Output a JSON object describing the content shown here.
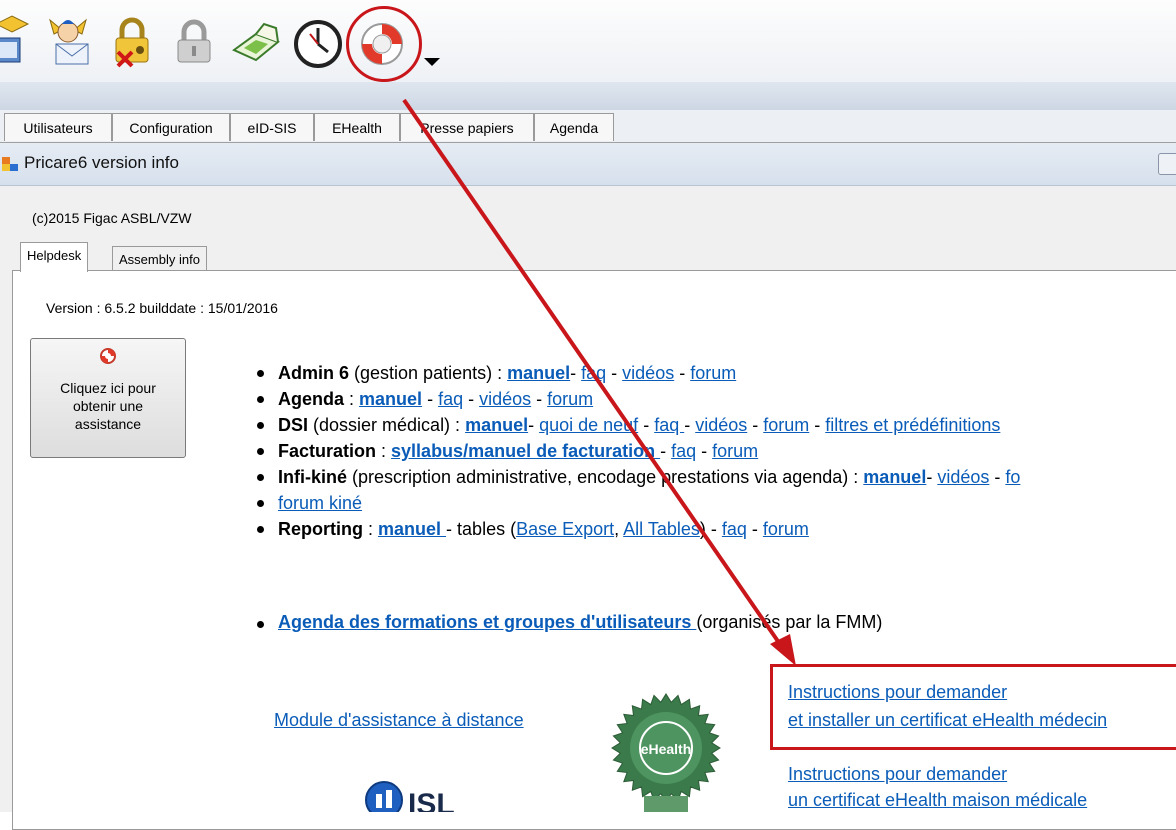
{
  "toolbar": {
    "icons": [
      "agenda-envelope-icon",
      "user-mail-icon",
      "lock-key-icon",
      "padlock-icon",
      "card-reader-icon",
      "clock-icon",
      "lifebuoy-icon",
      "dropdown-arrow-icon"
    ]
  },
  "main_tabs": [
    "Utilisateurs",
    "Configuration",
    "eID-SIS",
    "EHealth",
    "Presse papiers",
    "Agenda"
  ],
  "window": {
    "title": "Pricare6 version info"
  },
  "dialog": {
    "copyright": "(c)2015 Figac ASBL/VZW",
    "tabs": [
      "Helpdesk",
      "Assembly info"
    ],
    "version": "Version : 6.5.2 builddate : 15/01/2016",
    "assist_button": "Cliquez ici pour obtenir une assistance"
  },
  "topics": {
    "admin": {
      "name": "Admin 6",
      "desc": " (gestion patients) : ",
      "manuel": "manuel",
      "faq": "faq",
      "videos": "vidéos",
      "forum": "forum"
    },
    "agenda": {
      "name": "Agenda",
      "desc": " : ",
      "manuel": "manuel",
      "faq": "faq",
      "videos": "vidéos",
      "forum": "forum"
    },
    "dsi": {
      "name": "DSI",
      "desc": " (dossier médical) : ",
      "manuel": "manuel",
      "quoi_neuf": "quoi de neuf",
      "faq": "faq ",
      "videos": "vidéos",
      "forum": "forum",
      "filtres": "filtres et prédéfinitions"
    },
    "facturation": {
      "name": "Facturation",
      "desc": " : ",
      "syllabus": "syllabus/manuel de facturation ",
      "faq": "faq",
      "forum": "forum"
    },
    "infi": {
      "name": "Infi-kiné",
      "desc": " (prescription administrative, encodage prestations via agenda) : ",
      "manuel": "manuel",
      "videos": "vidéos",
      "forum_cut": "fo",
      "forum_kine": "forum kiné"
    },
    "reporting": {
      "name": "Reporting",
      "desc": " : ",
      "manuel": "manuel ",
      "tables": " - tables (",
      "base_export": "Base Export",
      "all_tables": "All Tables",
      "faq": "faq",
      "forum": "forum"
    },
    "agenda_formations": {
      "link": "Agenda des formations et groupes d'utilisateurs ",
      "suffix": "(organisés par la FMM)"
    }
  },
  "links": {
    "module": "Module d'assistance à distance",
    "instr1_line1": "Instructions pour demander",
    "instr1_line2": "et installer un certificat eHealth médecin",
    "instr2_line1": "Instructions pour demander",
    "instr2_line2": "un certificat eHealth maison médicale"
  },
  "logos": {
    "ehealth": "eHealth",
    "isl": "ISL"
  },
  "colors": {
    "link": "#0a5cb8",
    "annotation": "#c8161b"
  }
}
